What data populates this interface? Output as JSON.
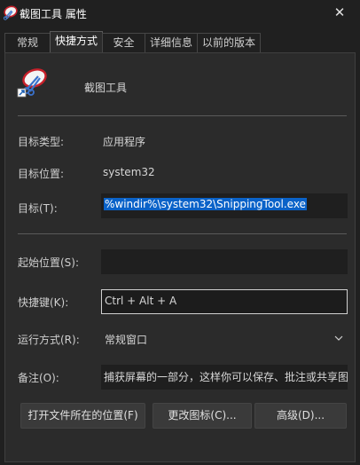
{
  "window": {
    "title": "截图工具 属性",
    "close_glyph": "✕"
  },
  "tabs": [
    {
      "label": "常规"
    },
    {
      "label": "快捷方式",
      "active": true
    },
    {
      "label": "安全"
    },
    {
      "label": "详细信息"
    },
    {
      "label": "以前的版本"
    }
  ],
  "header": {
    "app_name": "截图工具",
    "icon": "snipping-tool-shortcut-icon"
  },
  "fields": {
    "target_type": {
      "label": "目标类型:",
      "value": "应用程序"
    },
    "target_location": {
      "label": "目标位置:",
      "value": "system32"
    },
    "target": {
      "label": "目标(T):",
      "value": "%windir%\\system32\\SnippingTool.exe"
    },
    "start_in": {
      "label": "起始位置(S):",
      "value": ""
    },
    "shortcut_key": {
      "label": "快捷键(K):",
      "value": "Ctrl + Alt + A"
    },
    "run": {
      "label": "运行方式(R):",
      "value": "常规窗口"
    },
    "comment": {
      "label": "备注(O):",
      "value": "捕获屏幕的一部分，这样你可以保存、批注或共享图像。"
    }
  },
  "buttons": {
    "open_location": "打开文件所在的位置(F)",
    "change_icon": "更改图标(C)...",
    "advanced": "高级(D)..."
  },
  "colors": {
    "background": "#202020",
    "panel": "#2b2b2b",
    "selection": "#0a62c8"
  }
}
